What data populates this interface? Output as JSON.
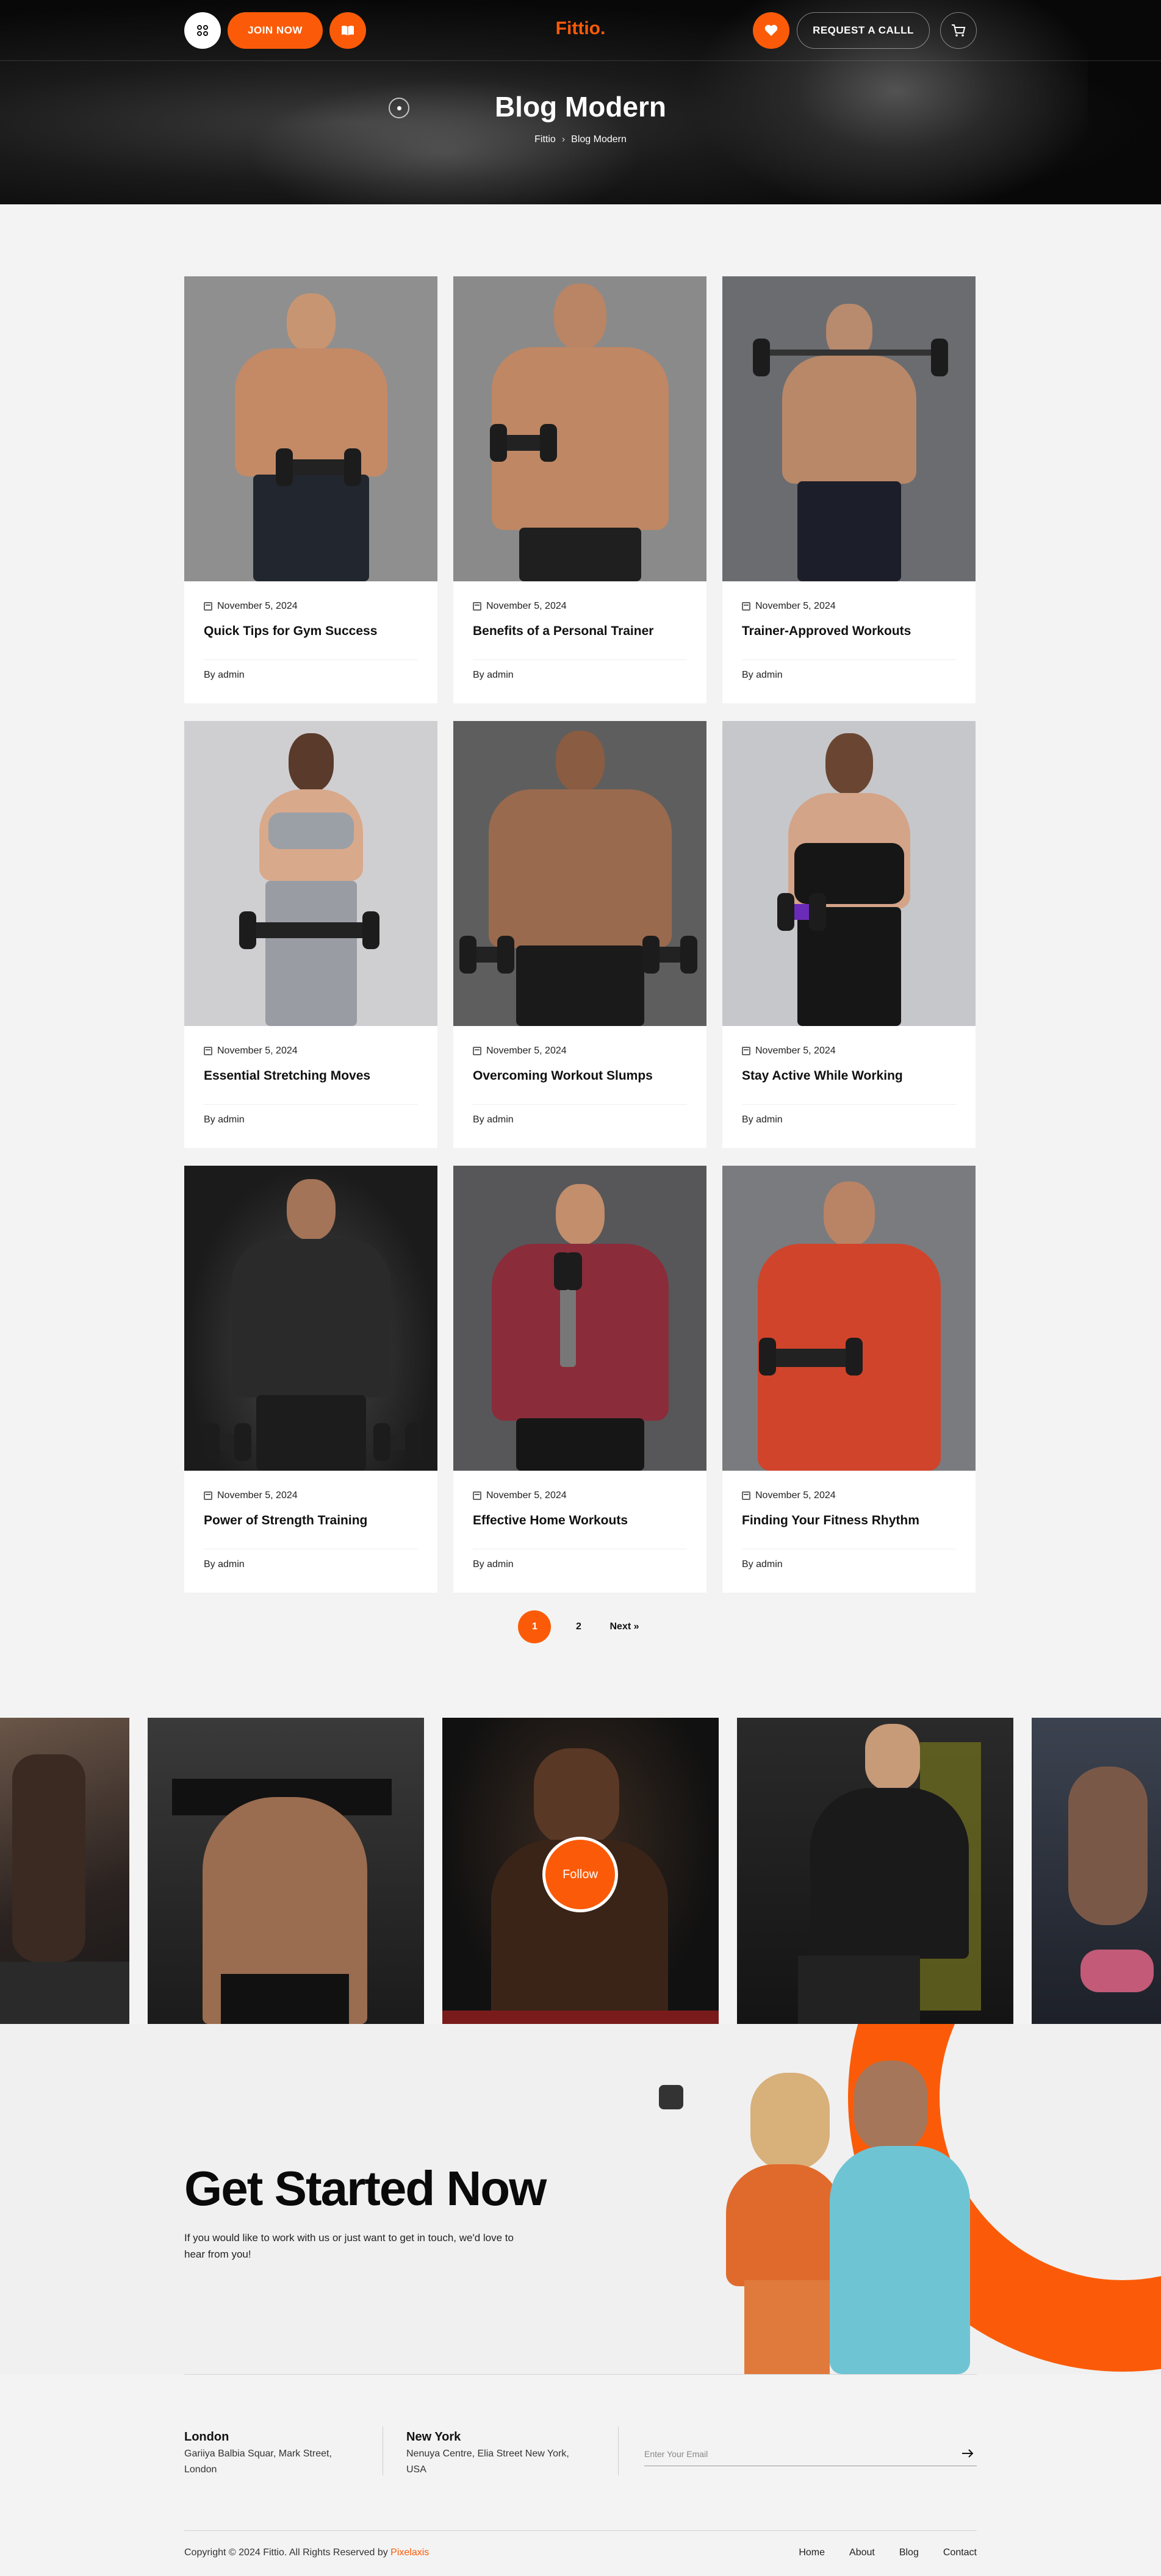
{
  "header": {
    "join_label": "JOIN NOW",
    "logo_text": "Fittio",
    "request_label": "REQUEST A CALLL",
    "icons": [
      "grid-icon",
      "book-icon",
      "heart-icon",
      "cart-icon"
    ]
  },
  "hero": {
    "title": "Blog Modern",
    "breadcrumb": [
      "Fittio",
      "Blog Modern"
    ],
    "breadcrumb_sep": "›"
  },
  "posts": [
    {
      "date": "November 5, 2024",
      "title": "Quick Tips for Gym Success",
      "author": "By admin"
    },
    {
      "date": "November 5, 2024",
      "title": "Benefits of a Personal Trainer",
      "author": "By admin"
    },
    {
      "date": "November 5, 2024",
      "title": "Trainer-Approved Workouts",
      "author": "By admin"
    },
    {
      "date": "November 5, 2024",
      "title": "Essential Stretching Moves",
      "author": "By admin"
    },
    {
      "date": "November 5, 2024",
      "title": "Overcoming Workout Slumps",
      "author": "By admin"
    },
    {
      "date": "November 5, 2024",
      "title": "Stay Active While Working",
      "author": "By admin"
    },
    {
      "date": "November 5, 2024",
      "title": "Power of Strength Training",
      "author": "By admin"
    },
    {
      "date": "November 5, 2024",
      "title": "Effective Home Workouts",
      "author": "By admin"
    },
    {
      "date": "November 5, 2024",
      "title": "Finding Your Fitness Rhythm",
      "author": "By admin"
    }
  ],
  "pagination": {
    "pages": [
      "1",
      "2"
    ],
    "current": "1",
    "next_label": "Next »"
  },
  "instagram": {
    "follow_label": "Follow"
  },
  "cta": {
    "title": "Get Started Now",
    "text": "If you would like to work with us or just want to get in touch, we'd love to hear from you!"
  },
  "footer": {
    "locations": [
      {
        "city": "London",
        "address": "Gariiya Balbia Squar, Mark Street, London"
      },
      {
        "city": "New York",
        "address": "Nenuya Centre, Elia Street New York, USA"
      }
    ],
    "email_placeholder": "Enter Your Email",
    "copyright_prefix": "Copyright © 2024 Fittio. All Rights Reserved by ",
    "copyright_brand": "Pixelaxis",
    "nav": [
      "Home",
      "About",
      "Blog",
      "Contact"
    ]
  },
  "colors": {
    "accent": "#fb5b08",
    "dark": "#0a0a0a",
    "page_bg": "#f3f3f3"
  }
}
